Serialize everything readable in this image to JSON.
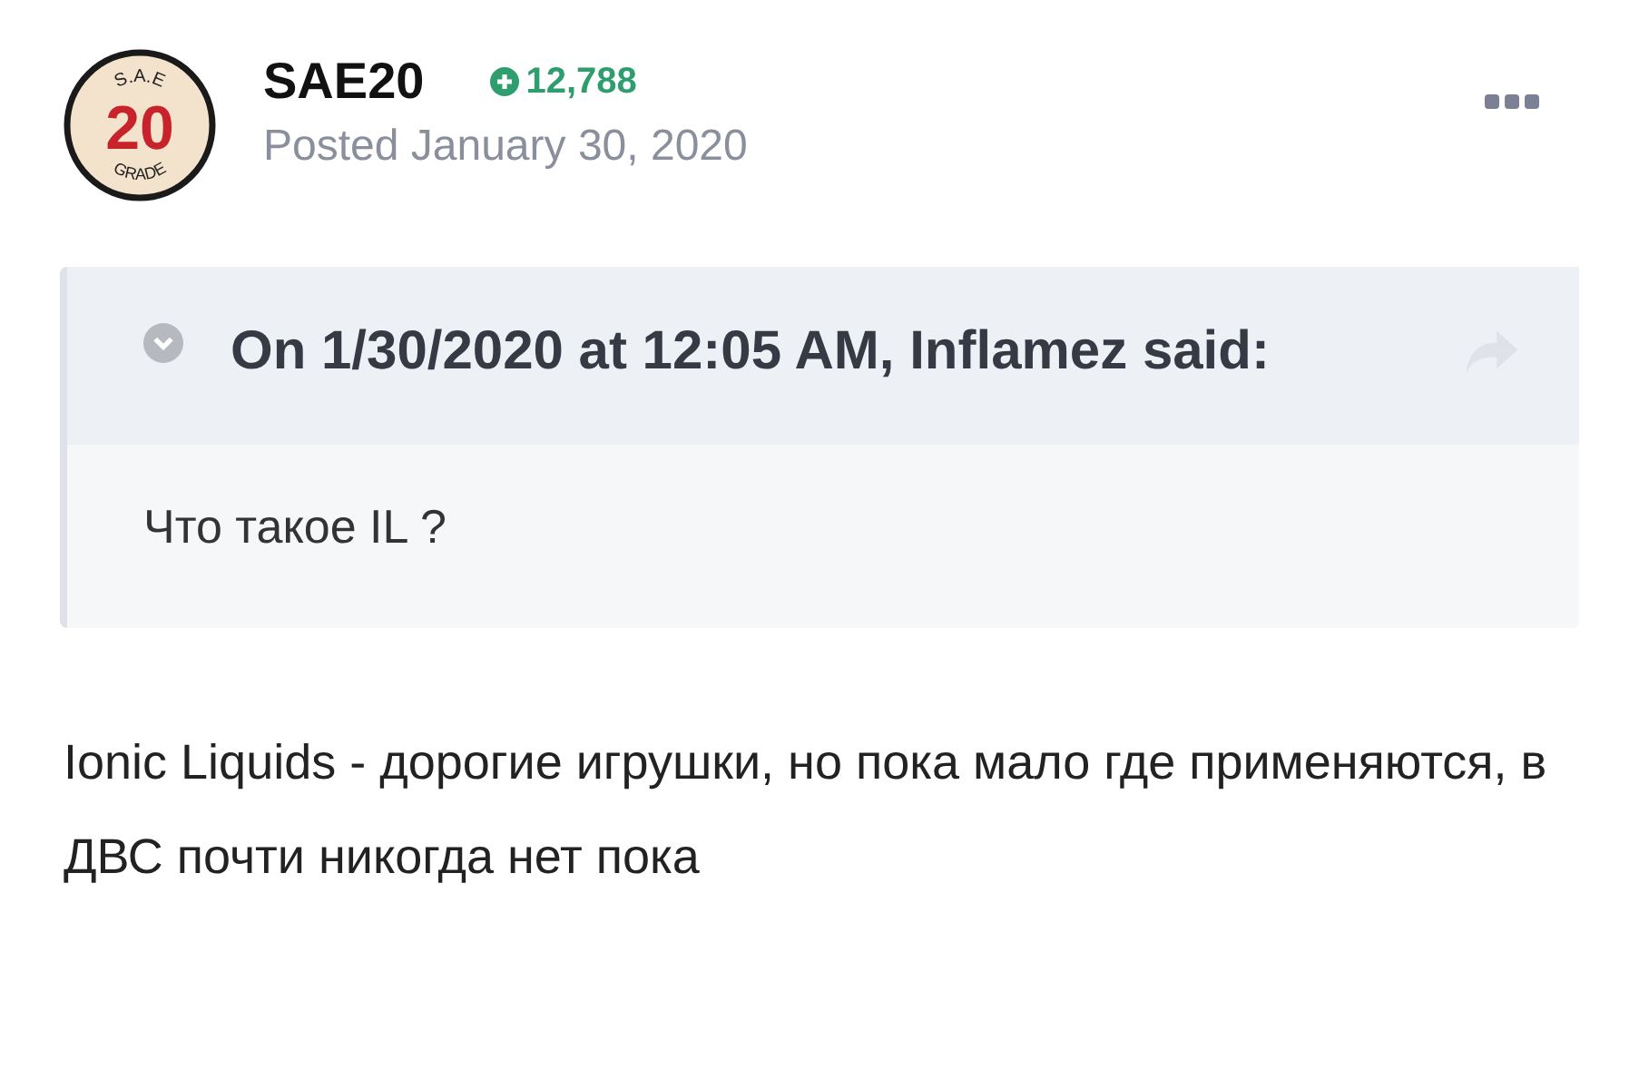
{
  "author": {
    "avatar": {
      "top": "S.A.E",
      "number": "20",
      "bottom": "GRADE"
    },
    "name": "SAE20",
    "reputation": "12,788",
    "posted": "Posted January 30, 2020"
  },
  "quote": {
    "citation": "On 1/30/2020 at 12:05 AM, Inflamez said:",
    "expanded": false,
    "text": "Что такое IL ?"
  },
  "body": "Ionic Liquids - дорогие игрушки, но пока мало где применяются, в ДВС почти никогда нет пока"
}
